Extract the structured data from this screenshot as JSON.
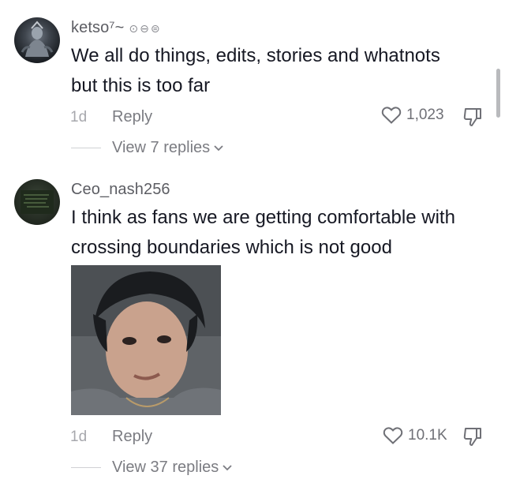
{
  "comments": [
    {
      "username": "ketso⁷~",
      "badges": "⊙⊖⊜",
      "text_line1": "We all do things, edits, stories and whatnots",
      "text_line2": "but this is too far",
      "time": "1d",
      "reply_label": "Reply",
      "like_count": "1,023",
      "view_replies": "View 7 replies",
      "avatar_icon": "avatar-figure-icon"
    },
    {
      "username": "Ceo_nash256",
      "badges": "",
      "text_line1": "I think as fans we are getting comfortable with",
      "text_line2": "crossing boundaries which is not good",
      "time": "1d",
      "reply_label": "Reply",
      "like_count": "10.1K",
      "view_replies": "View 37 replies",
      "avatar_icon": "avatar-green-screen-icon"
    }
  ],
  "colors": {
    "text": "#161823",
    "secondary": "#7b7c82",
    "muted": "#a7a8ad",
    "background": "#ffffff"
  }
}
